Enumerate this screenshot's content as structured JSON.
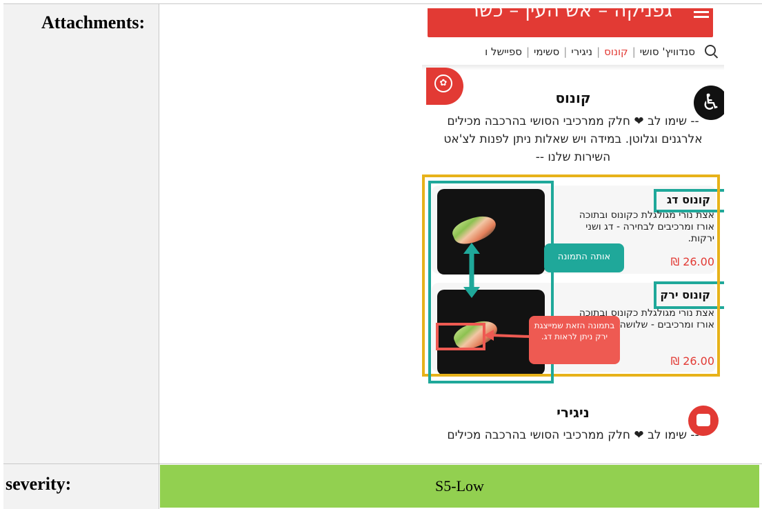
{
  "labels": {
    "attachments": "Attachments:",
    "severity": "severity:"
  },
  "severity_value": "S5-Low",
  "colors": {
    "severity_bg": "#92d050",
    "label_bg": "#f2f2f2",
    "brand_red": "#e23a34",
    "annotation_teal": "#1fa89a",
    "annotation_yellow": "#e7b21a",
    "annotation_red": "#ee5a52"
  },
  "screenshot": {
    "header_title": "גפניקה – אש העין – כשר",
    "nav_items": [
      "סנדוויץ' סושי",
      "קונוס",
      "ניגירי",
      "סשימי",
      "ספיישל ו"
    ],
    "nav_active": "קונוס",
    "section1_title": "קונוס",
    "section1_note": "-- שימו לב ❤ חלק ממרכיבי הסושי בהרכבה מכילים אלרגנים וגלוטן. במידה ויש שאלות ניתן לפנות לצ'אט השירות שלנו --",
    "items": [
      {
        "title": "קונוס דג",
        "desc": "אצת נורי מגולגלת כקונוס ובתוכה אורז ומרכיבים לבחירה - דג ושני ירקות.",
        "price": "₪ 26.00"
      },
      {
        "title": "קונוס ירק",
        "desc": "אצת נורי מגולגלת כקונוס ובתוכה אורז ומרכיבים - שלושה ירקות.",
        "price": "₪ 26.00"
      }
    ],
    "callout_same_image": "אותה התמונה",
    "callout_fish": "בתמונה הזאת שמייצגת ירק ניתן לראות דג.",
    "section2_title": "ניגירי",
    "section2_note": "-- שימו לב ❤ חלק ממרכיבי הסושי בהרכבה מכילים",
    "icons": [
      "menu-icon",
      "search-icon",
      "badge-icon",
      "accessibility-icon",
      "chat-icon"
    ]
  }
}
